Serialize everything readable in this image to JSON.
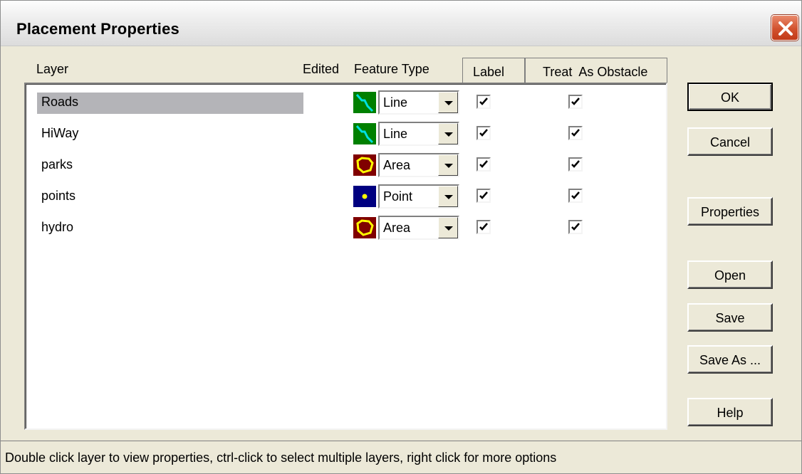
{
  "window": {
    "title": "Placement Properties",
    "close_icon": "close-icon"
  },
  "columns": {
    "layer": "Layer",
    "edited": "Edited",
    "feature_type": "Feature Type",
    "label": "Label",
    "treat_as_obstacle": "Treat  As Obstacle"
  },
  "layers": [
    {
      "name": "Roads",
      "selected": true,
      "icon": "line-icon",
      "feature_type": "Line",
      "label": true,
      "obstacle": true
    },
    {
      "name": "HiWay",
      "selected": false,
      "icon": "line-icon",
      "feature_type": "Line",
      "label": true,
      "obstacle": true
    },
    {
      "name": "parks",
      "selected": false,
      "icon": "area-icon",
      "feature_type": "Area",
      "label": true,
      "obstacle": true
    },
    {
      "name": "points",
      "selected": false,
      "icon": "point-icon",
      "feature_type": "Point",
      "label": true,
      "obstacle": true
    },
    {
      "name": "hydro",
      "selected": false,
      "icon": "area-icon",
      "feature_type": "Area",
      "label": true,
      "obstacle": true
    }
  ],
  "buttons": {
    "ok": "OK",
    "cancel": "Cancel",
    "properties": "Properties",
    "open": "Open",
    "save": "Save",
    "save_as": "Save As ...",
    "help": "Help"
  },
  "status": "Double click layer to view properties, ctrl-click to select multiple layers, right click for more options",
  "colors": {
    "line_icon_bg": "#008000",
    "line_icon_fg": "#00e0e0",
    "area_icon_bg": "#800000",
    "area_icon_fg": "#ffff00",
    "point_icon_bg": "#000080",
    "point_icon_fg": "#ffff00"
  }
}
